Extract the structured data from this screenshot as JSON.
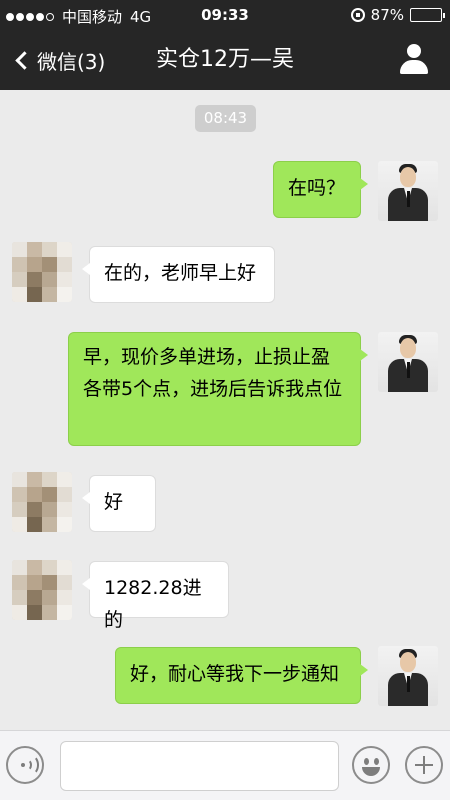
{
  "status_bar": {
    "carrier": "中国移动",
    "network": "4G",
    "time": "09:33",
    "battery_percent": "87%",
    "battery_level": 0.87
  },
  "header": {
    "back_label": "微信(3)",
    "title": "实仓12万—吴"
  },
  "chat": {
    "timestamp": "08:43",
    "messages": [
      {
        "side": "out",
        "text": "在吗？"
      },
      {
        "side": "in",
        "text": "在的，老师早上好"
      },
      {
        "side": "out",
        "text": "早，现价多单进场，止损止盈各带5个点，进场后告诉我点位"
      },
      {
        "side": "in",
        "text": "好"
      },
      {
        "side": "in",
        "text": "1282.28进的"
      },
      {
        "side": "out",
        "text": "好，耐心等我下一步通知"
      }
    ]
  },
  "input_bar": {
    "text_value": ""
  },
  "colors": {
    "header_bg": "#262626",
    "chat_bg": "#ebebeb",
    "outgoing_bubble": "#a0e75a",
    "incoming_bubble": "#ffffff"
  },
  "icons": [
    "signal-icon",
    "lock-rotation-icon",
    "battery-icon",
    "back-chevron-icon",
    "profile-icon",
    "voice-icon",
    "emoji-icon",
    "plus-icon"
  ]
}
